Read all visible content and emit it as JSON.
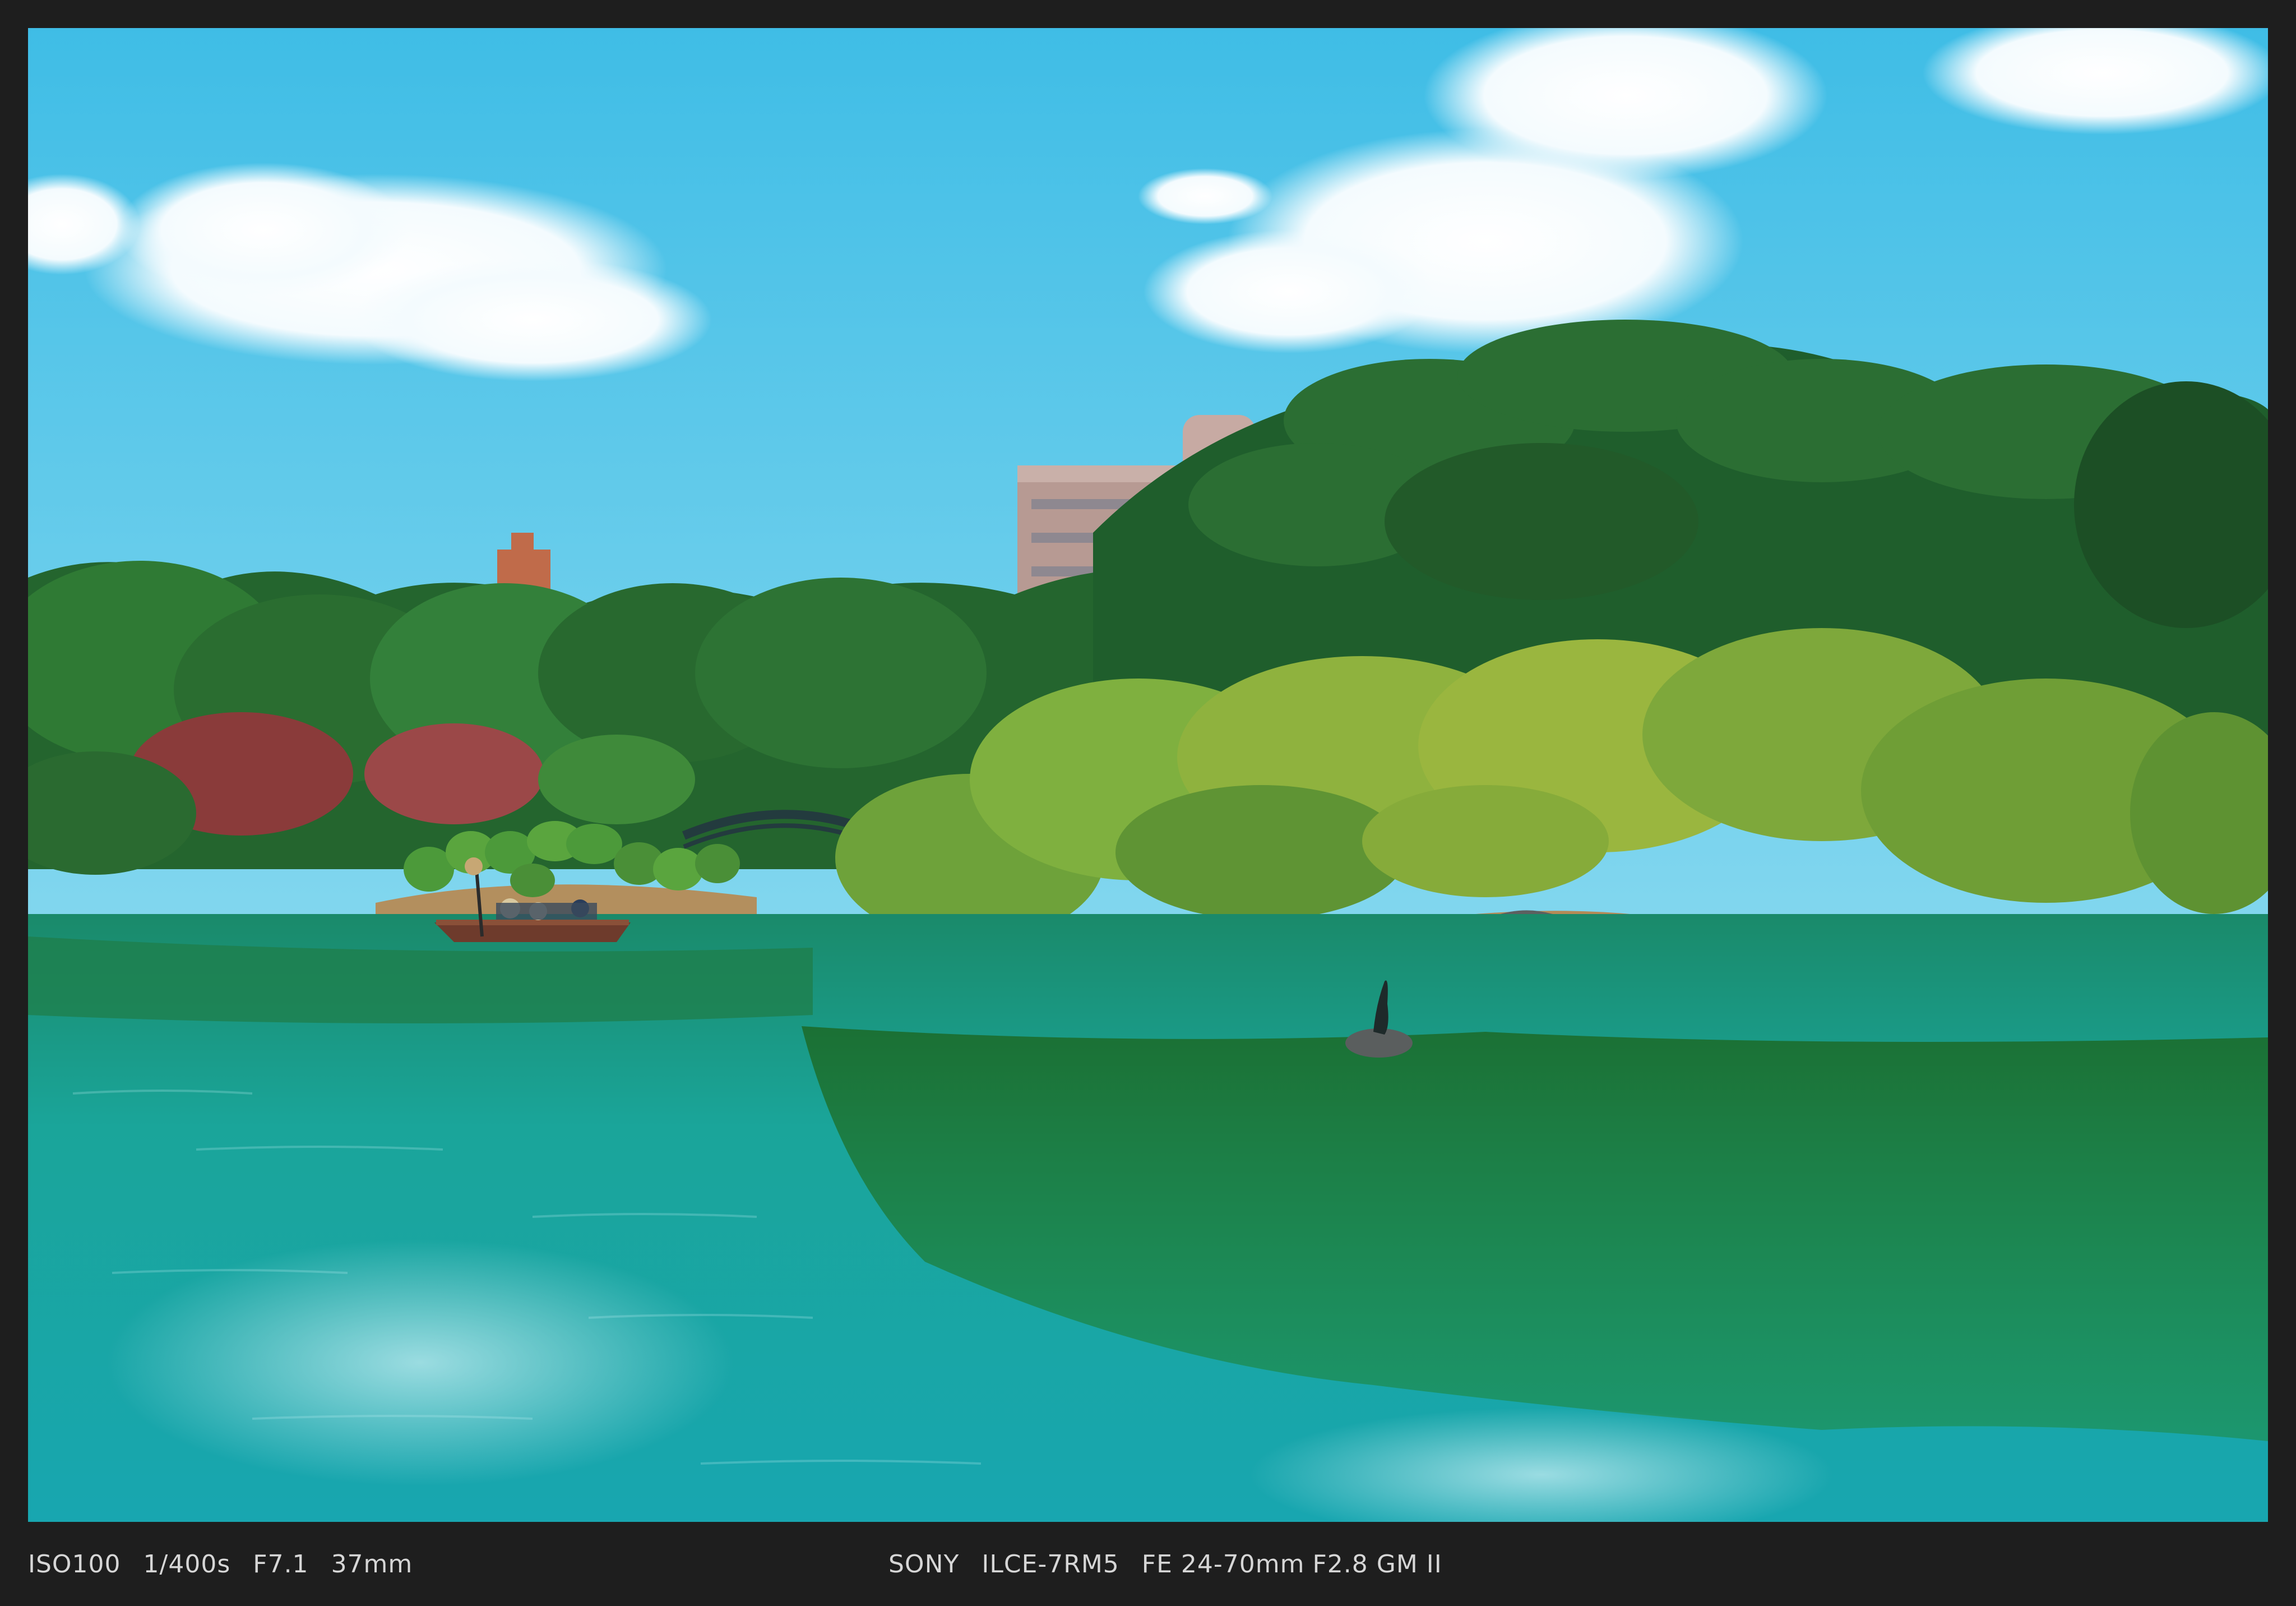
{
  "photo": {
    "subject": "Japanese garden pond with wooden boat, trees and reflections",
    "colors": {
      "sky_top": "#3fbde6",
      "sky_bottom": "#7fd6ef",
      "foliage_dark": "#1f5e2c",
      "foliage_mid": "#3f8a34",
      "foliage_light": "#8fb23e",
      "water_teal": "#1b9c94",
      "water_green": "#1f7a3a",
      "frame": "#1e1e1e",
      "text": "#d6d6d6"
    }
  },
  "exif": {
    "iso": "ISO100",
    "shutter": "1/400s",
    "aperture": "F7.1",
    "focal_length": "37mm"
  },
  "camera": {
    "brand": "SONY",
    "model": "ILCE-7RM5",
    "lens_name": "FE 24-70mm",
    "lens_spec": "F2.8 GM II"
  }
}
